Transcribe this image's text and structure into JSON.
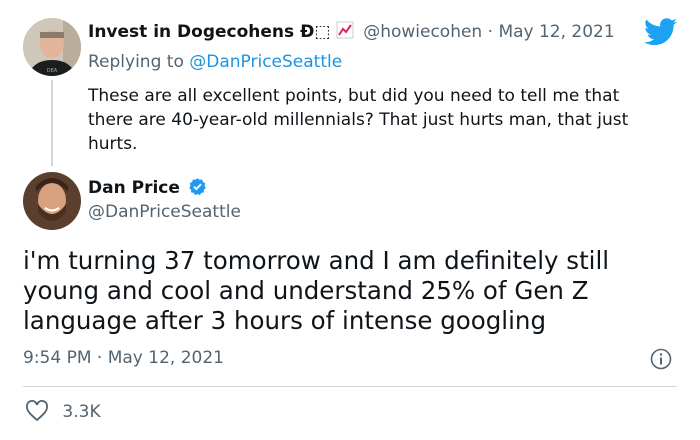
{
  "colors": {
    "accent": "#1b95e0",
    "text": "#0f1419",
    "muted": "#536471",
    "divider": "#cfd9de"
  },
  "parent_tweet": {
    "author": {
      "display_name": "Invest in Dogecohens Ð⬚",
      "chart_emoji": "chart-up-icon",
      "handle": "@howiecohen"
    },
    "separator": "·",
    "date": "May 12, 2021",
    "reply_prefix": "Replying to",
    "reply_to": "@DanPriceSeattle",
    "text": "These are all excellent points, but did you need to tell me that there are 40-year-old millennials? That just hurts man, that just hurts."
  },
  "main_tweet": {
    "author": {
      "display_name": "Dan Price",
      "handle": "@DanPriceSeattle",
      "verified": true
    },
    "text": "i'm turning 37 tomorrow and I am definitely still young and cool and understand 25% of Gen Z language after 3 hours of intense googling",
    "time": "9:54 PM",
    "separator": "·",
    "date": "May 12, 2021",
    "likes": "3.3K"
  },
  "icons": {
    "brand": "twitter-bird-icon",
    "info": "info-icon",
    "like": "heart-icon",
    "verified": "verified-badge-icon"
  }
}
